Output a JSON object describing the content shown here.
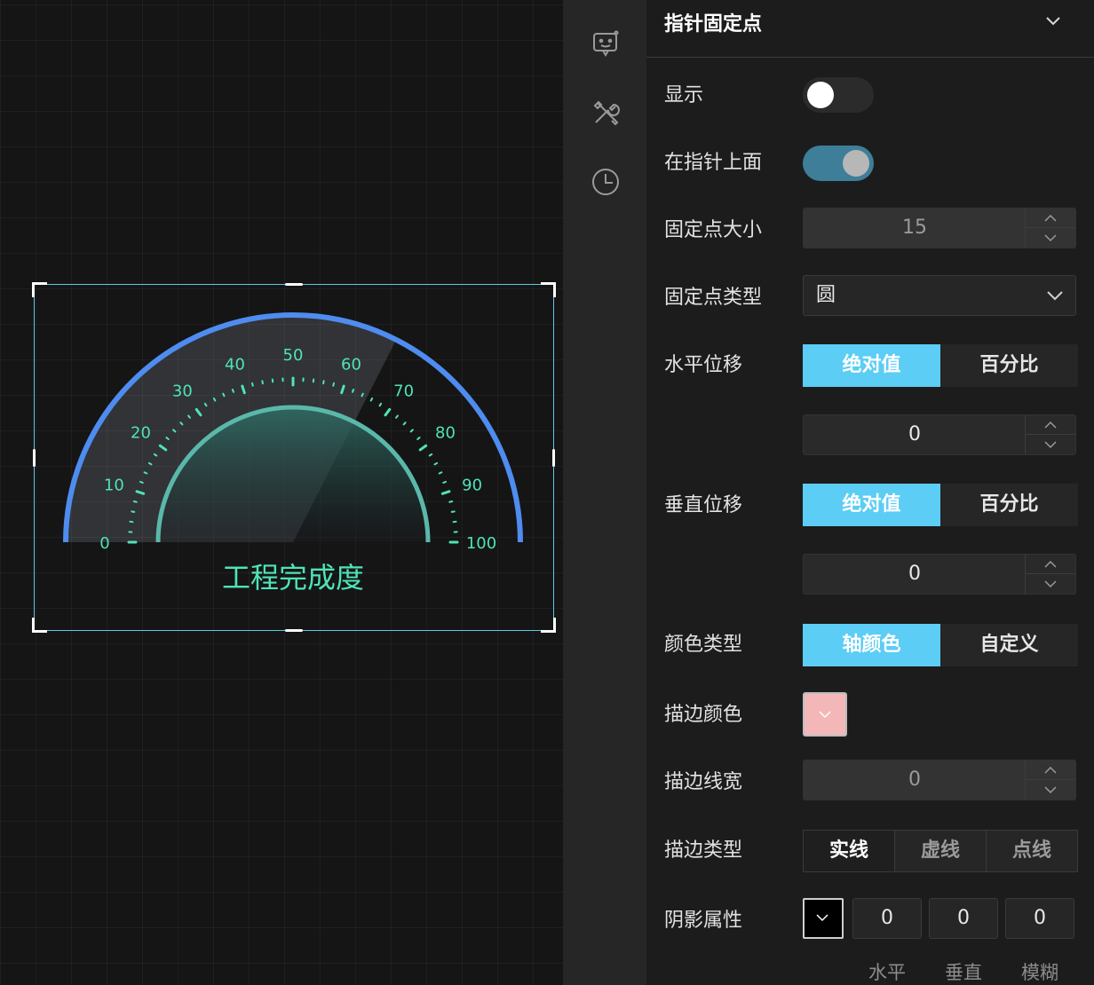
{
  "gauge": {
    "title": "工程完成度",
    "min": 0,
    "max": 100,
    "tick_labels": [
      "0",
      "10",
      "20",
      "30",
      "40",
      "50",
      "60",
      "70",
      "80",
      "90",
      "100"
    ],
    "value": 65,
    "colors": {
      "axis_arc": "#4f8cf0",
      "ticks": "#4fe3b8",
      "inner_arc": "#5ab8aa",
      "title": "#4fe3b8"
    }
  },
  "icon_strip": [
    "chat-bot-icon",
    "tools-icon",
    "clock-icon"
  ],
  "panel": {
    "title": "指针固定点",
    "rows": {
      "show": {
        "label": "显示",
        "on": false
      },
      "above_pointer": {
        "label": "在指针上面",
        "on": true
      },
      "point_size": {
        "label": "固定点大小",
        "value": "15"
      },
      "point_type": {
        "label": "固定点类型",
        "value": "圆"
      },
      "h_offset": {
        "label": "水平位移",
        "options": [
          "绝对值",
          "百分比"
        ],
        "selected": "绝对值",
        "value": "0"
      },
      "v_offset": {
        "label": "垂直位移",
        "options": [
          "绝对值",
          "百分比"
        ],
        "selected": "绝对值",
        "value": "0"
      },
      "color_type": {
        "label": "颜色类型",
        "options": [
          "轴颜色",
          "自定义"
        ],
        "selected": "轴颜色"
      },
      "stroke_color": {
        "label": "描边颜色",
        "color": "#f3b7b8"
      },
      "stroke_width": {
        "label": "描边线宽",
        "value": "0"
      },
      "stroke_type": {
        "label": "描边类型",
        "options": [
          "实线",
          "虚线",
          "点线"
        ],
        "selected": "实线"
      },
      "shadow": {
        "label": "阴影属性",
        "color": "#000000",
        "values": [
          "0",
          "0",
          "0"
        ],
        "captions": [
          "水平",
          "垂直",
          "模糊"
        ]
      }
    }
  }
}
